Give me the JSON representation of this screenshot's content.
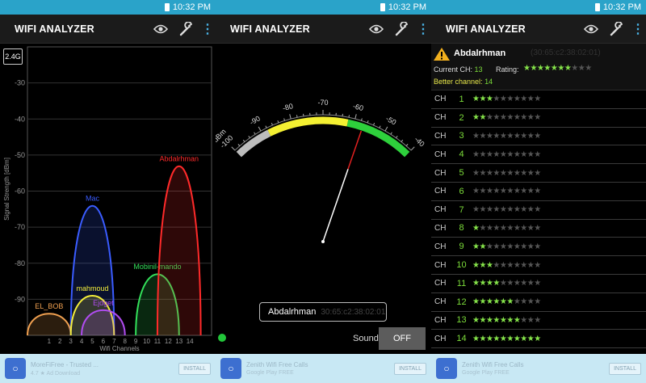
{
  "status": {
    "time": "10:32 PM"
  },
  "app": {
    "title": "WIFI ANALYZER"
  },
  "panel1": {
    "band_label": "2.4G",
    "chart_data": {
      "type": "area",
      "xlabel": "Wifi Channels",
      "ylabel": "Signal Strength [dBm]",
      "x_ticks": [
        1,
        2,
        3,
        4,
        5,
        6,
        7,
        8,
        9,
        10,
        11,
        12,
        13,
        14
      ],
      "y_ticks": [
        -30,
        -40,
        -50,
        -60,
        -70,
        -80,
        -90
      ],
      "xlim": [
        -1,
        16
      ],
      "ylim": [
        -100,
        -20
      ],
      "series": [
        {
          "name": "EL_BOB",
          "center": 1,
          "dbm": -94,
          "color": "#f0a050"
        },
        {
          "name": "Mac",
          "center": 5,
          "dbm": -64,
          "color": "#3a5cff"
        },
        {
          "name": "mahmoud",
          "center": 5,
          "dbm": -89,
          "color": "#f4ee3a"
        },
        {
          "name": "Ejdget",
          "center": 6,
          "dbm": -93,
          "color": "#b04cf0"
        },
        {
          "name": "Mobinil-mando",
          "center": 11,
          "dbm": -83,
          "color": "#33e05a"
        },
        {
          "name": "Abdalrhman",
          "center": 13,
          "dbm": -53,
          "color": "#ff2a2a"
        }
      ]
    }
  },
  "panel2": {
    "gauge": {
      "unit": "dBm",
      "ticks": [
        -100,
        -90,
        -80,
        -70,
        -60,
        -50,
        -40
      ],
      "value": -57
    },
    "ssid": "Abdalrhman",
    "ssid_mac": "30:65:c2:38:02:01",
    "sound_label": "Sound",
    "sound_button": "OFF"
  },
  "panel3": {
    "ap_name": "Abdalrhman",
    "ap_mac": "(30:65:c2:38:02:01)",
    "current_ch_label": "Current CH:",
    "current_ch": "13",
    "rating_label": "Rating:",
    "rating": 7,
    "better_label": "Better channel:",
    "better_ch": "14",
    "channel_prefix": "CH",
    "channels": [
      {
        "n": "1",
        "stars": 3
      },
      {
        "n": "2",
        "stars": 1.5
      },
      {
        "n": "3",
        "stars": 0
      },
      {
        "n": "4",
        "stars": 0
      },
      {
        "n": "5",
        "stars": 0
      },
      {
        "n": "6",
        "stars": 0
      },
      {
        "n": "7",
        "stars": 0
      },
      {
        "n": "8",
        "stars": 1
      },
      {
        "n": "9",
        "stars": 2
      },
      {
        "n": "10",
        "stars": 3
      },
      {
        "n": "11",
        "stars": 4
      },
      {
        "n": "12",
        "stars": 5.5
      },
      {
        "n": "13",
        "stars": 7
      },
      {
        "n": "14",
        "stars": 10
      }
    ]
  },
  "ads": [
    {
      "title": "MoreFiFree - Trusted ...",
      "sub": "4.7  ★  Ad Download",
      "button": "INSTALL"
    },
    {
      "title": "Zenith Wifi Free Calls",
      "sub": "Google Play   FREE",
      "button": "INSTALL"
    },
    {
      "title": "Zenith Wifi Free Calls",
      "sub": "Google Play   FREE",
      "button": "INSTALL"
    }
  ]
}
